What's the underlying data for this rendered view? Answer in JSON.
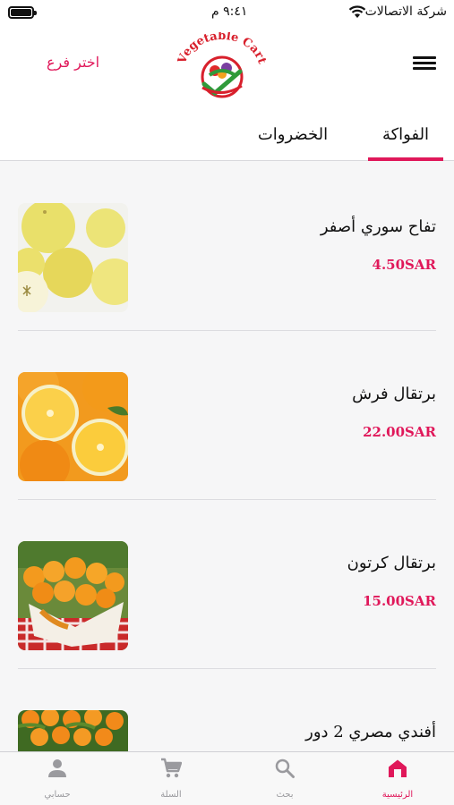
{
  "status_bar": {
    "carrier": "شركة الاتصالات",
    "time": "٩:٤١ م"
  },
  "header": {
    "branch_button": "اختر فرع",
    "logo_text": "Vegetable Cart"
  },
  "tabs": [
    {
      "label": "الفواكة",
      "active": true
    },
    {
      "label": "الخضروات",
      "active": false
    }
  ],
  "products": [
    {
      "name": "تفاح سوري أصفر",
      "price": "4.50SAR",
      "image": "yellow-apples"
    },
    {
      "name": "برتقال فرش",
      "price": "22.00SAR",
      "image": "oranges-halved"
    },
    {
      "name": "برتقال كرتون",
      "price": "15.00SAR",
      "image": "oranges-box"
    },
    {
      "name": "أفندي مصري 2 دور",
      "price": "",
      "image": "tangerines"
    }
  ],
  "tab_bar": [
    {
      "label": "الرئيسية",
      "icon": "home-icon",
      "active": true
    },
    {
      "label": "بحث",
      "icon": "search-icon",
      "active": false
    },
    {
      "label": "السلة",
      "icon": "cart-icon",
      "active": false
    },
    {
      "label": "حسابي",
      "icon": "person-icon",
      "active": false
    }
  ],
  "colors": {
    "accent": "#e0185a",
    "background": "#f6f6f7",
    "inactive_icon": "#9a9a9e"
  }
}
